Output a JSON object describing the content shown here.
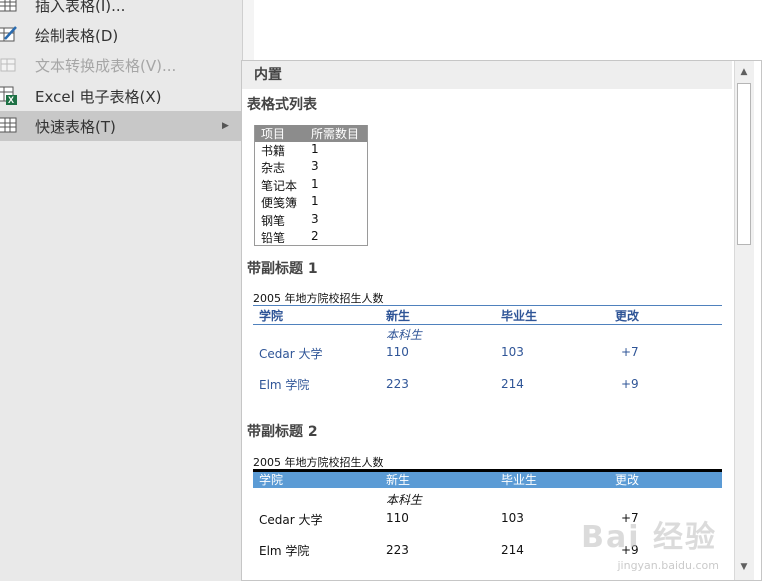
{
  "menu": {
    "items": [
      {
        "label": "插入表格(I)...",
        "disabled": false
      },
      {
        "label": "绘制表格(D)",
        "disabled": false
      },
      {
        "label": "文本转换成表格(V)...",
        "disabled": true
      },
      {
        "label": "Excel 电子表格(X)",
        "disabled": false
      },
      {
        "label": "快速表格(T)",
        "disabled": false,
        "active": true
      }
    ],
    "submenu_arrow": "▶"
  },
  "gallery": {
    "header": "内置",
    "sections": [
      {
        "title": "表格式列表",
        "table": {
          "headers": [
            "项目",
            "所需数目"
          ],
          "rows": [
            [
              "书籍",
              "1"
            ],
            [
              "杂志",
              "3"
            ],
            [
              "笔记本",
              "1"
            ],
            [
              "便笺簿",
              "1"
            ],
            [
              "钢笔",
              "3"
            ],
            [
              "铅笔",
              "2"
            ]
          ]
        }
      },
      {
        "title": "带副标题 1",
        "caption": "2005  年地方院校招生人数",
        "headers": [
          "学院",
          "新生",
          "毕业生",
          "更改"
        ],
        "subtitle": "本科生",
        "rows": [
          [
            "Cedar 大学",
            "110",
            "103",
            "+7"
          ],
          [
            "Elm 学院",
            "223",
            "214",
            "+9"
          ]
        ]
      },
      {
        "title": "带副标题 2",
        "caption": "2005  年地方院校招生人数",
        "headers": [
          "学院",
          "新生",
          "毕业生",
          "更改"
        ],
        "subtitle": "本科生",
        "rows": [
          [
            "Cedar 大学",
            "110",
            "103",
            "+7"
          ],
          [
            "Elm 学院",
            "223",
            "214",
            "+9"
          ]
        ]
      }
    ],
    "scroll_up": "▲",
    "scroll_down": "▼"
  },
  "watermark": {
    "text": "Bai 经验",
    "sub": "jingyan.baidu.com"
  },
  "colors": {
    "accent": "#5b9bd5",
    "header_gray": "#8c8c8c",
    "link_blue": "#2f5597"
  }
}
